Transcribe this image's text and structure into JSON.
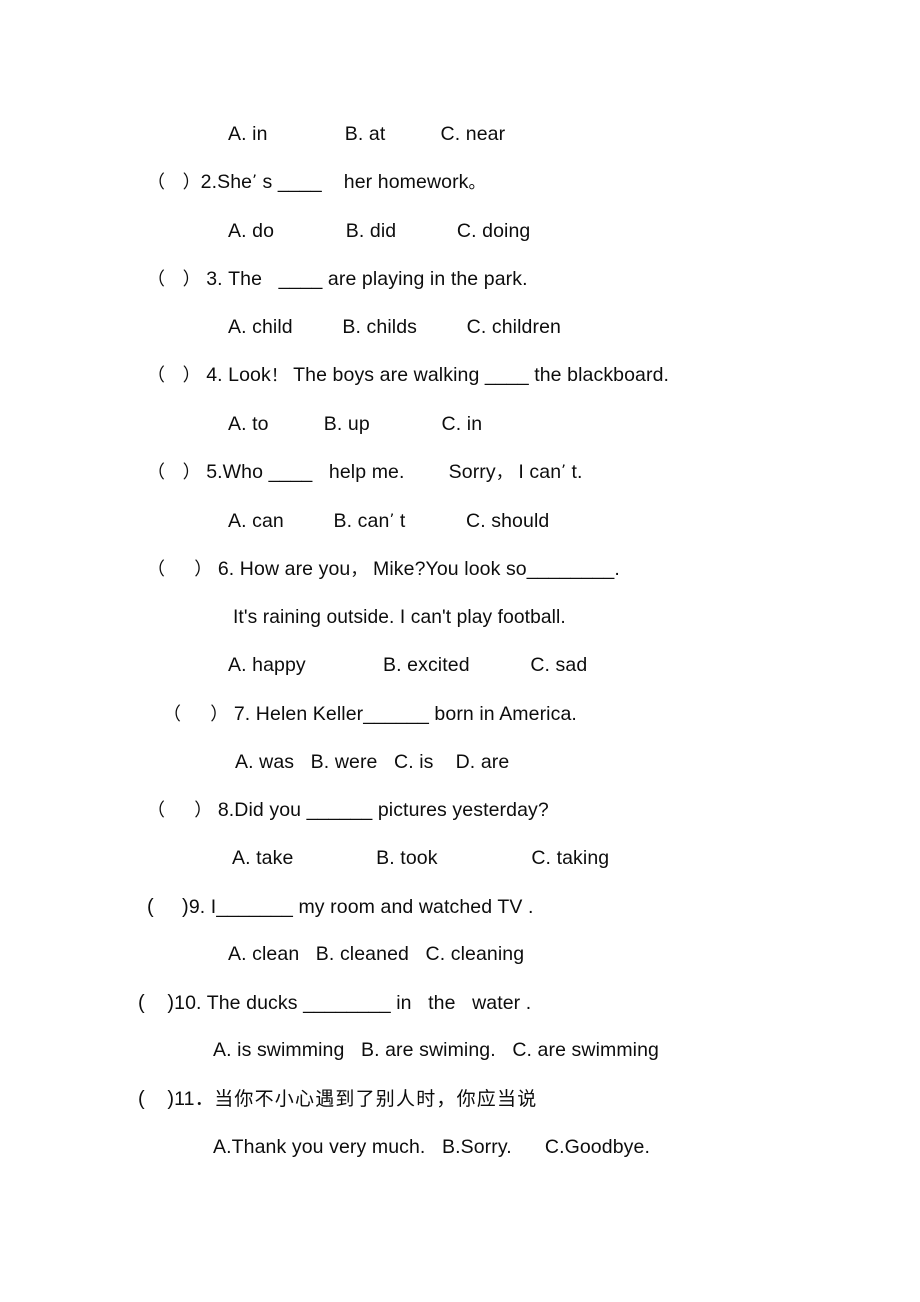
{
  "document": {
    "type": "exam-worksheet",
    "language": "English with Chinese instructions",
    "page_background": "#ffffff",
    "text_color": "#0d0d0d"
  },
  "lines": {
    "q1_options": "A. in              B. at          C. near",
    "q2_bracket": "（   ）",
    "q2_stem_a": "2.She",
    "q2_apos": "’",
    "q2_stem_b": " s ",
    "q2_blank": "____",
    "q2_stem_c": "    her homework",
    "q2_period": "。",
    "q2_options": "A. do             B. did           C. doing",
    "q3_bracket": "（   ）",
    "q3_stem_a": " 3. The   ",
    "q3_blank": "____",
    "q3_stem_b": " are playing in the park.",
    "q3_options": "A. child         B. childs         C. children",
    "q4_bracket": "（   ）",
    "q4_stem_a": " 4. Look",
    "q4_excl": "！",
    "q4_stem_b": " The boys are walking ",
    "q4_blank": "____",
    "q4_stem_c": " the blackboard.",
    "q4_options": "A. to          B. up             C. in",
    "q5_bracket": "（   ）",
    "q5_stem_a": " 5.Who ",
    "q5_blank": "____",
    "q5_stem_b": "   help me.        Sorry",
    "q5_comma": "，",
    "q5_stem_c": " I can",
    "q5_apos": "’",
    "q5_stem_d": " t.",
    "q5_options_a": "A. can         B. can",
    "q5_options_apos": "’",
    "q5_options_b": " t           C. should",
    "q6_bracket": "（     ）",
    "q6_stem_a": " 6. How are you",
    "q6_comma": "，",
    "q6_stem_b": " Mike?You look so",
    "q6_blank": "________",
    "q6_stem_c": ".",
    "q6_extra": "It's raining outside. I can't play football.",
    "q6_options": "A. happy              B. excited           C. sad",
    "q7_bracket": "（     ）",
    "q7_stem_a": " 7. Helen Keller",
    "q7_blank": "______",
    "q7_stem_b": " born in America.",
    "q7_options": "A. was   B. were   C. is    D. are",
    "q8_bracket": "（     ）",
    "q8_stem_a": " 8.Did you ",
    "q8_blank": "______",
    "q8_stem_b": " pictures yesterday?",
    "q8_options": "A. take               B. took                 C. taking",
    "q9_bracket": "(     )",
    "q9_stem_a": "9. I",
    "q9_blank": "_______",
    "q9_stem_b": " my room and watched TV .",
    "q9_options": "A. clean   B. cleaned   C. cleaning",
    "q10_bracket": "(    )",
    "q10_stem_a": "10. The ducks ",
    "q10_blank": "________",
    "q10_stem_b": " in   the   water .",
    "q10_options": "A. is swimming   B. are swiming.   C. are swimming",
    "q11_bracket": "(    )",
    "q11_number": "11．",
    "q11_chinese": "当你不小心遇到了别人时，你应当说",
    "q11_options": "A.Thank you very much.   B.Sorry.      C.Goodbye."
  }
}
